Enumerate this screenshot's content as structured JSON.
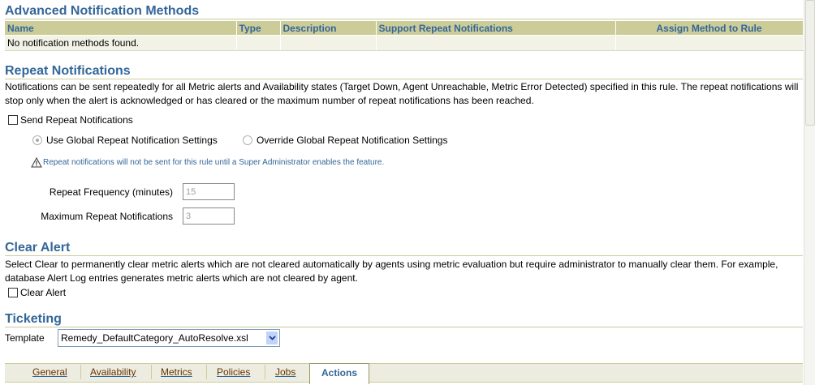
{
  "advanced_methods": {
    "title": "Advanced Notification Methods",
    "columns": [
      "Name",
      "Type",
      "Description",
      "Support Repeat Notifications",
      "Assign Method to Rule"
    ],
    "empty_message": "No notification methods found."
  },
  "repeat": {
    "title": "Repeat Notifications",
    "description": "Notifications can be sent repeatedly for all Metric alerts and Availability states (Target Down, Agent Unreachable, Metric Error Detected) specified in this rule. The repeat notifications will stop only when the alert is acknowledged or has cleared or the maximum number of repeat notifications has been reached.",
    "send_label": "Send Repeat Notifications",
    "send_checked": false,
    "use_global_label": "Use Global Repeat Notification Settings",
    "override_label": "Override Global Repeat Notification Settings",
    "warning": "Repeat notifications will not be sent for this rule until a Super Administrator enables the feature.",
    "frequency_label": "Repeat Frequency (minutes)",
    "frequency_value": "15",
    "max_label": "Maximum Repeat Notifications",
    "max_value": "3"
  },
  "clear_alert": {
    "title": "Clear Alert",
    "description": "Select Clear to permanently clear metric alerts which are not cleared automatically by agents using metric evaluation but require administrator to manually clear them. For example, database Alert Log entries generates metric alerts which are not cleared by agent.",
    "checkbox_label": "Clear Alert",
    "checked": false
  },
  "ticketing": {
    "title": "Ticketing",
    "template_label": "Template",
    "template_value": "Remedy_DefaultCategory_AutoResolve.xsl"
  },
  "tabs": {
    "general": "General",
    "availability": "Availability",
    "metrics": "Metrics",
    "policies": "Policies",
    "jobs": "Jobs",
    "actions": "Actions",
    "active": "Actions"
  },
  "colors": {
    "header_text": "#336699",
    "header_bg": "#cccc99",
    "row_bg": "#f2f2e6",
    "link": "#663300"
  },
  "icons": {
    "warning": "warning-triangle-icon",
    "dropdown": "chevron-down-icon"
  }
}
